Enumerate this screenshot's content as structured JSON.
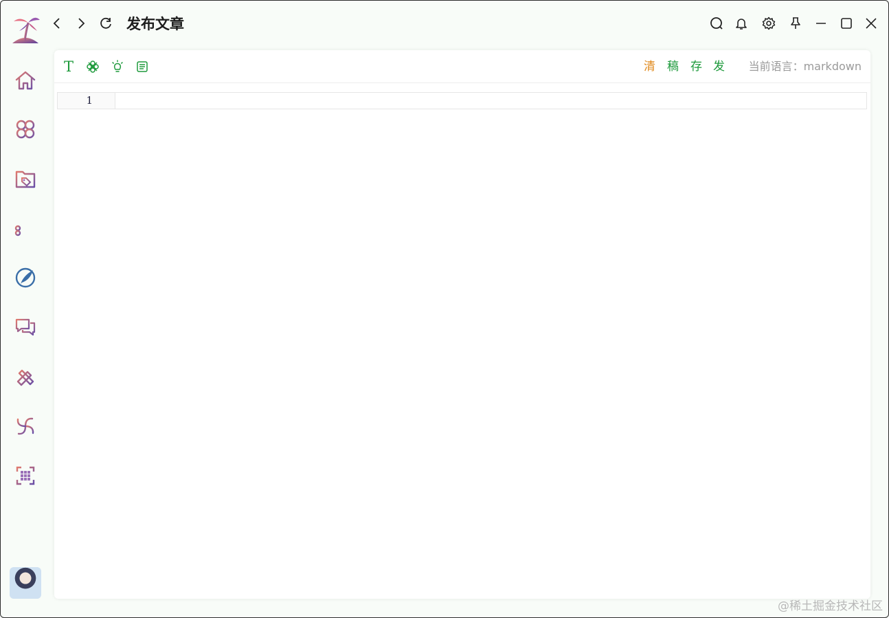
{
  "titlebar": {
    "title": "发布文章"
  },
  "sidebar": {
    "items": [
      {
        "icon": "home-icon"
      },
      {
        "icon": "apps-icon"
      },
      {
        "icon": "tag-folder-icon"
      },
      {
        "icon": "list-filter-icon"
      },
      {
        "icon": "pen-edit-icon"
      },
      {
        "icon": "chat-icon"
      },
      {
        "icon": "tools-icon"
      },
      {
        "icon": "spiral-icon"
      },
      {
        "icon": "grid-scan-icon"
      }
    ]
  },
  "toolbar": {
    "tools": [
      "text-icon",
      "flower-icon",
      "bulb-icon",
      "document-icon"
    ],
    "text_tool": "T",
    "actions": {
      "clear": "清",
      "draft": "稿",
      "save": "存",
      "publish": "发"
    },
    "language": "当前语言：markdown"
  },
  "editor": {
    "line_numbers": [
      "1"
    ]
  },
  "watermark": "@稀土掘金技术社区",
  "colors": {
    "accent_green": "#1e9a3c",
    "clear_orange": "#e08a1e",
    "icon_gradient_start": "#e07a6e",
    "icon_gradient_end": "#6a4fa8"
  }
}
